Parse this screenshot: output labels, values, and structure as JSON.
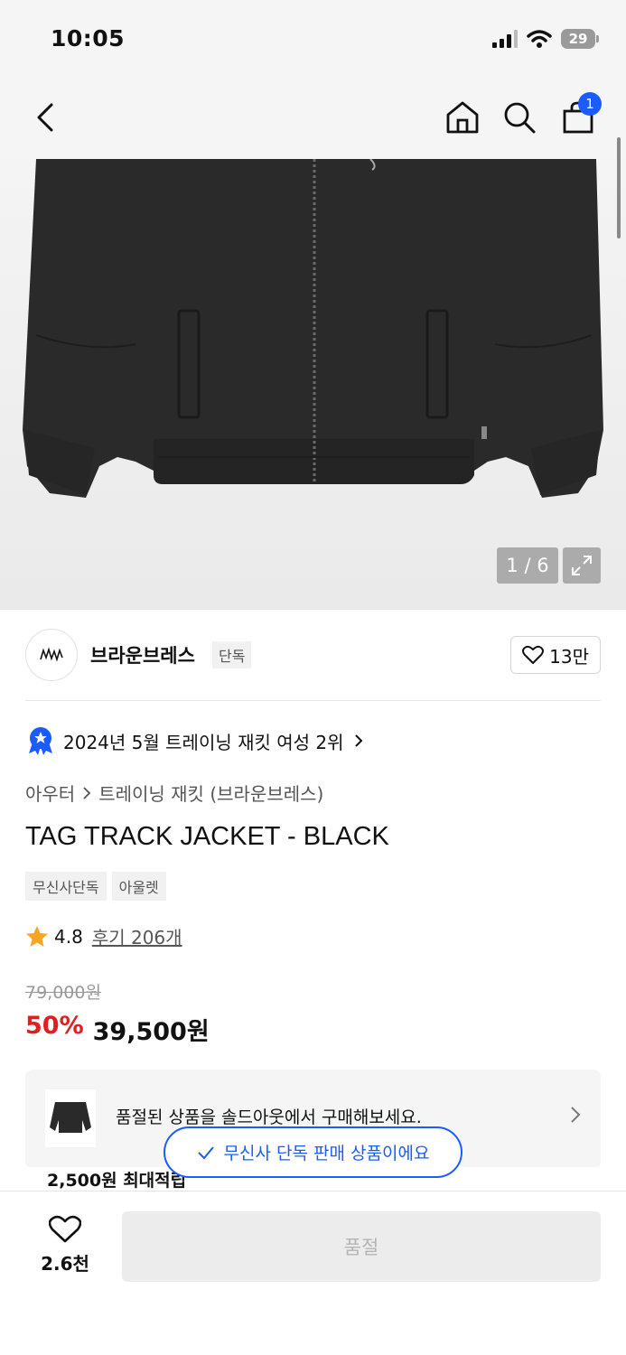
{
  "status_bar": {
    "time": "10:05",
    "battery": "29"
  },
  "nav": {
    "cart_count": "1"
  },
  "gallery": {
    "counter": "1 / 6"
  },
  "brand": {
    "name": "브라운브레스",
    "tag": "단독",
    "likes": "13만"
  },
  "ranking": {
    "text": "2024년 5월 트레이닝 재킷 여성 2위"
  },
  "breadcrumb": {
    "category": "아우터",
    "subcategory": "트레이닝 재킷 (브라운브레스)"
  },
  "product": {
    "title": "TAG TRACK JACKET - BLACK",
    "tags": [
      "무신사단독",
      "아울렛"
    ],
    "rating": "4.8",
    "review_label": "후기 206개",
    "original_price": "79,000원",
    "discount": "50%",
    "price": "39,500원"
  },
  "soldout_card": {
    "text": "품절된 상품을 솔드아웃에서 구매해보세요."
  },
  "points": {
    "text": "2,500원 최대적립"
  },
  "toast": {
    "text": "무신사 단독 판매 상품이에요"
  },
  "bottom_bar": {
    "wish_count": "2.6천",
    "buy_label": "품절"
  },
  "icons": [
    "back-icon",
    "home-icon",
    "search-icon",
    "bag-icon",
    "expand-icon",
    "heart-icon",
    "star-icon",
    "chevron-right-icon",
    "check-icon",
    "ranking-badge-icon"
  ],
  "colors": {
    "accent": "#1a5cff",
    "discount": "#e02020",
    "star": "#f5a623"
  }
}
